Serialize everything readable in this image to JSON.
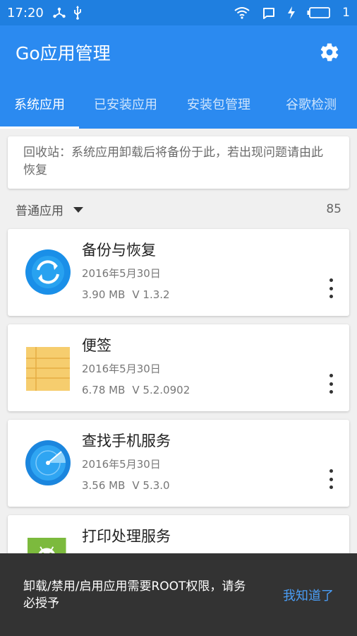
{
  "status": {
    "time": "17:20",
    "icons_left": [
      "share-icon",
      "usb-icon"
    ],
    "icons_right": [
      "wifi-icon",
      "message-icon",
      "charging-icon",
      "battery-icon"
    ],
    "battery_text": "1"
  },
  "appbar": {
    "title": "Go应用管理",
    "settings_icon": "gear-icon",
    "color": "#2b8af0"
  },
  "tabs": [
    {
      "label": "系统应用",
      "active": true
    },
    {
      "label": "已安装应用",
      "active": false
    },
    {
      "label": "安装包管理",
      "active": false
    },
    {
      "label": "谷歌检测",
      "active": false
    }
  ],
  "recycle_bin": {
    "text": "回收站：系统应用卸载后将备份于此，若出现问题请由此恢复"
  },
  "section": {
    "label": "普通应用",
    "count": "85"
  },
  "apps": [
    {
      "name": "备份与恢复",
      "date": "2016年5月30日",
      "size": "3.90 MB",
      "version": "V 1.3.2",
      "icon": "backup-restore-icon"
    },
    {
      "name": "便签",
      "date": "2016年5月30日",
      "size": "6.78 MB",
      "version": "V 5.2.0902",
      "icon": "notepad-icon"
    },
    {
      "name": "查找手机服务",
      "date": "2016年5月30日",
      "size": "3.56 MB",
      "version": "V 5.3.0",
      "icon": "radar-icon"
    },
    {
      "name": "打印处理服务",
      "date": "",
      "size": "",
      "version": "",
      "icon": "android-icon"
    }
  ],
  "snackbar": {
    "message": "卸载/禁用/启用应用需要ROOT权限，请务必授予",
    "action": "我知道了"
  }
}
